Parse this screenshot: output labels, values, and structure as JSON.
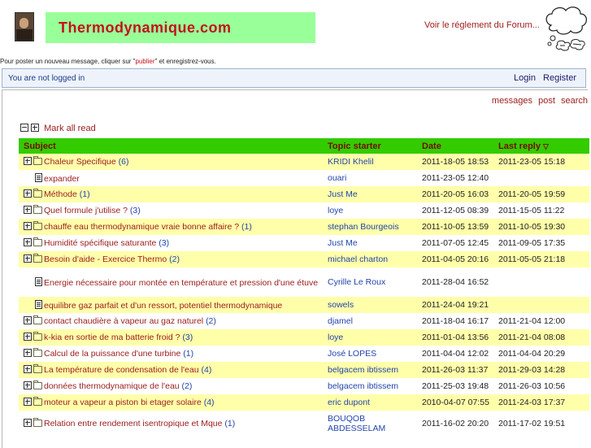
{
  "header": {
    "logo_text": "Thermodynamique.com",
    "rules_link": "Voir le réglement du Forum..."
  },
  "post_hint": {
    "before": "Pour poster un nouveau message, cliquer sur \"",
    "link": "publier",
    "after": "\" et enregistrez-vous."
  },
  "status_bar": {
    "not_logged": "You are not logged in",
    "login": "Login",
    "register": "Register"
  },
  "top_links": [
    "messages",
    "post",
    "search"
  ],
  "mark_all_read": "Mark all read",
  "table": {
    "headers": {
      "subject": "Subject",
      "starter": "Topic starter",
      "date": "Date",
      "last_reply": "Last reply",
      "sort_glyph": "▽"
    },
    "rows": [
      {
        "kind": "folder",
        "subject": "Chaleur Specifique",
        "count": "(6)",
        "starter": "KRIDI Khelil",
        "date": "2011-18-05 18:53",
        "last": "2011-23-05 15:18"
      },
      {
        "kind": "doc",
        "subject": "expander",
        "count": "",
        "starter": "ouari",
        "date": "2011-23-05 12:40",
        "last": ""
      },
      {
        "kind": "folder",
        "subject": "Méthode",
        "count": "(1)",
        "starter": "Just Me",
        "date": "2011-20-05 16:03",
        "last": "2011-20-05 19:59"
      },
      {
        "kind": "folder",
        "subject": "Quel formule j'utilise ?",
        "count": "(3)",
        "starter": "loye",
        "date": "2011-12-05 08:39",
        "last": "2011-15-05 11:22"
      },
      {
        "kind": "folder",
        "subject": "chauffe eau thermodynamique vraie bonne affaire ?",
        "count": "(1)",
        "starter": "stephan Bourgeois",
        "date": "2011-10-05 13:59",
        "last": "2011-10-05 19:30"
      },
      {
        "kind": "folder",
        "subject": "Humidité spécifique saturante",
        "count": "(3)",
        "starter": "Just Me",
        "date": "2011-07-05 12:45",
        "last": "2011-09-05 17:35"
      },
      {
        "kind": "folder",
        "subject": "Besoin d'aide - Exercice Thermo",
        "count": "(2)",
        "starter": "michael charton",
        "date": "2011-04-05 20:16",
        "last": "2011-05-05 21:18"
      },
      {
        "kind": "doc",
        "subject": "Energie nécessaire pour montée en température et pression d'une étuve",
        "count": "",
        "starter": "Cyrille Le Roux",
        "date": "2011-28-04 16:52",
        "last": ""
      },
      {
        "kind": "doc",
        "subject": "equilibre gaz parfait et d'un ressort, potentiel thermodynamique",
        "count": "",
        "starter": "sowels",
        "date": "2011-24-04 19:21",
        "last": ""
      },
      {
        "kind": "folder",
        "subject": "contact chaudière à vapeur au gaz naturel",
        "count": "(2)",
        "starter": "djamel",
        "date": "2011-18-04 16:17",
        "last": "2011-21-04 12:00"
      },
      {
        "kind": "folder",
        "subject": "k-kia en sortie de ma batterie froid ?",
        "count": "(3)",
        "starter": "loye",
        "date": "2011-01-04 13:56",
        "last": "2011-21-04 08:08"
      },
      {
        "kind": "folder",
        "subject": "Calcul de la puissance d'une turbine",
        "count": "(1)",
        "starter": "José LOPES",
        "date": "2011-04-04 12:02",
        "last": "2011-04-04 20:29"
      },
      {
        "kind": "folder",
        "subject": "La température de condensation de l'eau",
        "count": "(4)",
        "starter": "belgacem ibtissem",
        "date": "2011-26-03 11:37",
        "last": "2011-29-03 14:28"
      },
      {
        "kind": "folder",
        "subject": "données thermodynamique de l'eau",
        "count": "(2)",
        "starter": "belgacem ibtissem",
        "date": "2011-25-03 19:48",
        "last": "2011-26-03 10:56"
      },
      {
        "kind": "folder",
        "subject": "moteur a vapeur a piston bi etager solaire",
        "count": "(4)",
        "starter": "eric dupont",
        "date": "2010-04-07 07:55",
        "last": "2011-24-03 17:37"
      },
      {
        "kind": "folder",
        "subject": "Relation entre rendement isentropique et Mque",
        "count": "(1)",
        "starter": "BOUQOB ABDESSELAM",
        "date": "2011-16-02 20:20",
        "last": "2011-17-02 19:51"
      }
    ]
  }
}
